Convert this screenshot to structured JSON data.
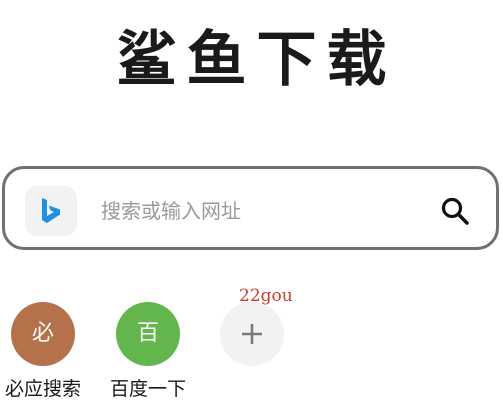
{
  "app": {
    "title": "鲨鱼下载"
  },
  "search": {
    "engine_icon": "bing-icon",
    "placeholder": "搜索或输入网址",
    "value": "",
    "search_icon": "search-icon",
    "engine_color": "#1e90e6"
  },
  "watermark": {
    "text": "22gou",
    "color": "#d23a2a"
  },
  "shortcuts": [
    {
      "label": "必应搜索",
      "glyph": "必",
      "color": "#b5714a"
    },
    {
      "label": "百度一下",
      "glyph": "百",
      "color": "#63b64b"
    },
    {
      "label": "",
      "glyph": "",
      "icon": "plus-icon",
      "color": "#f2f2f2"
    }
  ]
}
